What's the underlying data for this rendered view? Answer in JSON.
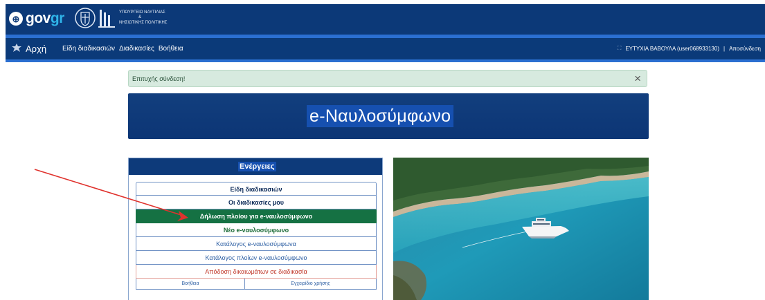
{
  "header": {
    "gov_logo_text_a": "gov",
    "gov_logo_text_b": "gr",
    "ministry_lines": [
      "ΥΠΟΥΡΓΕΙΟ ΝΑΥΤΙΛΙΑΣ",
      "&",
      "ΝΗΣΙΩΤΙΚΗΣ ΠΟΛΙΤΙΚΗΣ"
    ]
  },
  "nav": {
    "home_label": "Αρχή",
    "links": [
      "Είδη διαδικασιών",
      "Διαδικασίες",
      "Βοήθεια"
    ],
    "user": "ΕΥΤΥΧΙΑ ΒΑΒΟΥΛΑ (user068933130)",
    "separator": "|",
    "logout": "Αποσύνδεση"
  },
  "alert": {
    "message": "Επιτυχής σύνδεση!",
    "close": "×"
  },
  "banner": {
    "title": "e-Ναυλοσύμφωνο"
  },
  "actions": {
    "title": "Ενέργειες",
    "items": [
      "Είδη διαδικασιών",
      "Οι διαδικασίες μου",
      "Δήλωση πλοίου για e-ναυλοσύμφωνο",
      "Νέο e-ναυλοσύμφωνο",
      "Κατάλογος e-ναυλοσύμφωνα",
      "Κατάλογος πλοίων e-ναυλοσύμφωνο",
      "Απόδοση δικαιωμάτων σε διαδικασία"
    ],
    "footer_left": "Βοήθεια",
    "footer_right": "Εγχειρίδιο χρήσης"
  },
  "colors": {
    "navy": "#0c3978",
    "accent_blue": "#2b6fd1",
    "active_green": "#157143",
    "arrow_red": "#e0332e"
  },
  "icons": [
    "home-emblem-icon",
    "expand-icon",
    "close-icon"
  ]
}
